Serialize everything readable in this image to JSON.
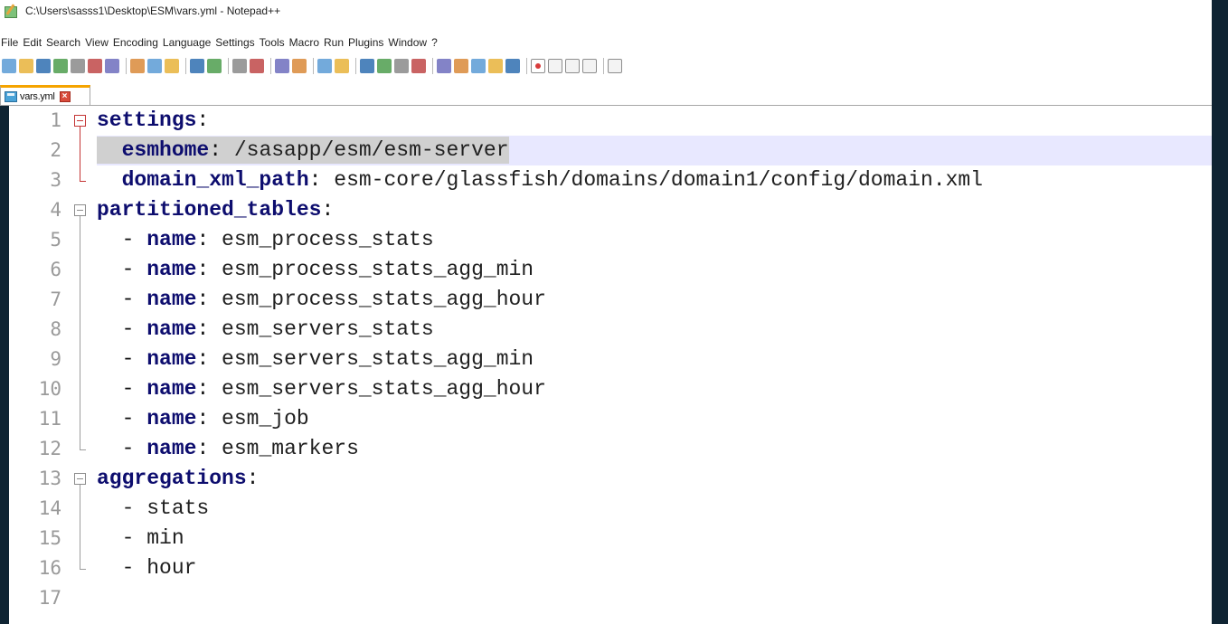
{
  "window": {
    "title": "C:\\Users\\sasss1\\Desktop\\ESM\\vars.yml - Notepad++"
  },
  "menu": [
    "File",
    "Edit",
    "Search",
    "View",
    "Encoding",
    "Language",
    "Settings",
    "Tools",
    "Macro",
    "Run",
    "Plugins",
    "Window",
    "?"
  ],
  "tab": {
    "label": "vars.yml",
    "accent": "#f5a400"
  },
  "editor": {
    "line_numbers": [
      "1",
      "2",
      "3",
      "4",
      "5",
      "6",
      "7",
      "8",
      "9",
      "10",
      "11",
      "12",
      "13",
      "14",
      "15",
      "16",
      "17"
    ],
    "lines": [
      {
        "key": "settings",
        "sep": ":",
        "value": "",
        "prefix": ""
      },
      {
        "key": "esmhome",
        "sep": ":",
        "value": " /sasapp/esm/esm-server",
        "prefix": "  "
      },
      {
        "key": "domain_xml_path",
        "sep": ":",
        "value": " esm-core/glassfish/domains/domain1/config/domain.xml",
        "prefix": "  "
      },
      {
        "key": "partitioned_tables",
        "sep": ":",
        "value": "",
        "prefix": ""
      },
      {
        "key": "name",
        "sep": ":",
        "value": " esm_process_stats",
        "prefix": "  - "
      },
      {
        "key": "name",
        "sep": ":",
        "value": " esm_process_stats_agg_min",
        "prefix": "  - "
      },
      {
        "key": "name",
        "sep": ":",
        "value": " esm_process_stats_agg_hour",
        "prefix": "  - "
      },
      {
        "key": "name",
        "sep": ":",
        "value": " esm_servers_stats",
        "prefix": "  - "
      },
      {
        "key": "name",
        "sep": ":",
        "value": " esm_servers_stats_agg_min",
        "prefix": "  - "
      },
      {
        "key": "name",
        "sep": ":",
        "value": " esm_servers_stats_agg_hour",
        "prefix": "  - "
      },
      {
        "key": "name",
        "sep": ":",
        "value": " esm_job",
        "prefix": "  - "
      },
      {
        "key": "name",
        "sep": ":",
        "value": " esm_markers",
        "prefix": "  - "
      },
      {
        "key": "aggregations",
        "sep": ":",
        "value": "",
        "prefix": ""
      },
      {
        "key": "",
        "sep": "",
        "value": "- stats",
        "prefix": "  "
      },
      {
        "key": "",
        "sep": "",
        "value": "- min",
        "prefix": "  "
      },
      {
        "key": "",
        "sep": "",
        "value": "- hour",
        "prefix": "  "
      },
      {
        "key": "",
        "sep": "",
        "value": "",
        "prefix": ""
      }
    ],
    "current_line": "2",
    "colors": {
      "key": "#0d0d6e",
      "current_line_bg": "#e8e8ff",
      "selection_bg": "#d0d0d0",
      "fold_marker": "#c43535"
    }
  },
  "toolbar_icons": [
    "new-file-icon",
    "open-file-icon",
    "save-icon",
    "save-all-icon",
    "close-icon",
    "close-all-icon",
    "print-icon",
    "cut-icon",
    "copy-icon",
    "paste-icon",
    "undo-icon",
    "redo-icon",
    "find-icon",
    "replace-icon",
    "zoom-in-icon",
    "zoom-out-icon",
    "sync-vertical-icon",
    "sync-horizontal-icon",
    "word-wrap-icon",
    "show-all-chars-icon",
    "indent-guide-icon",
    "udl-icon",
    "doc-map-icon",
    "function-list-icon",
    "folder-workspace-icon",
    "monitor-icon",
    "eye-icon",
    "record-macro-icon",
    "stop-macro-icon",
    "play-macro-icon",
    "run-macro-multiple-icon",
    "save-macro-icon"
  ]
}
